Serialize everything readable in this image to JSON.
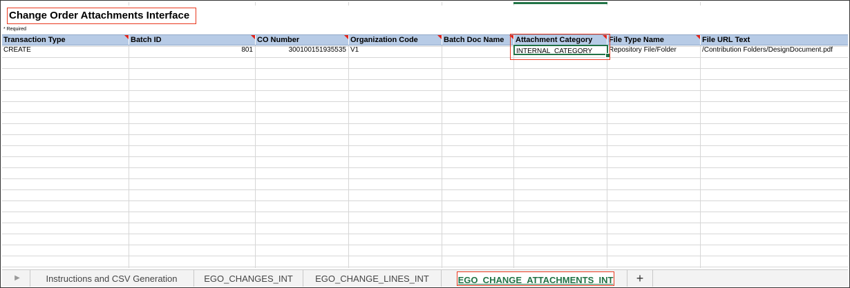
{
  "sheet": {
    "title": "Change Order Attachments Interface",
    "required_note": "* Required",
    "headers": [
      "Transaction Type",
      "Batch ID",
      "CO Number",
      "Organization Code",
      "Batch Doc Name",
      "Attachment Category",
      "File Type Name",
      "File URL Text"
    ],
    "row": {
      "transaction_type": "CREATE",
      "batch_id": "801",
      "co_number": "300100151935535",
      "organization_code": "V1",
      "batch_doc_name": "",
      "attachment_category": "INTERNAL_CATEGORY",
      "file_type_name": "Repository File/Folder",
      "file_url_text": "/Contribution Folders/DesignDocument.pdf"
    }
  },
  "tabs": {
    "items": [
      "Instructions and CSV Generation",
      "EGO_CHANGES_INT",
      "EGO_CHANGE_LINES_INT",
      "EGO_CHANGE_ATTACHMENTS_INT"
    ],
    "add_label": "+",
    "nav_icon": "play-triangle-icon"
  },
  "colors": {
    "header_bg": "#b7cbe6",
    "accent": "#217346",
    "highlight": "#e8361c",
    "flag": "#e2231a"
  }
}
